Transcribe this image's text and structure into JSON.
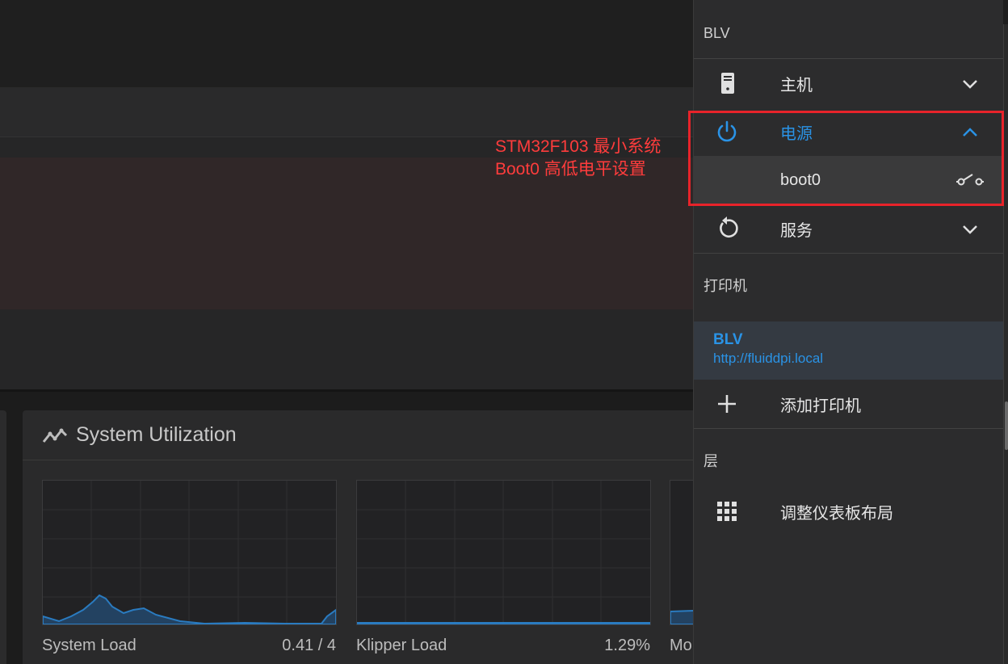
{
  "annotation": {
    "line1": "STM32F103 最小系统",
    "line2": "Boot0 高低电平设置"
  },
  "dashboard": {
    "card_title": "System Utilization",
    "graphs": [
      {
        "label": "System Load",
        "value": "0.41 / 4"
      },
      {
        "label": "Klipper Load",
        "value": "1.29%"
      },
      {
        "label": "Mo",
        "value": ""
      }
    ]
  },
  "drawer": {
    "section_host": "BLV",
    "items": {
      "host": {
        "label": "主机",
        "icon": "server-icon"
      },
      "power": {
        "label": "电源",
        "icon": "power-icon",
        "expanded": true
      },
      "boot0": {
        "label": "boot0",
        "icon": "toggle-switch-icon"
      },
      "services": {
        "label": "服务",
        "icon": "restart-icon"
      }
    },
    "section_printers": "打印机",
    "printer": {
      "name": "BLV",
      "url": "http://fluiddpi.local"
    },
    "add_printer": {
      "label": "添加打印机",
      "icon": "plus-icon"
    },
    "section_layout": "层",
    "adjust_layout": {
      "label": "调整仪表板布局",
      "icon": "grid-icon"
    }
  },
  "colors": {
    "accent": "#2a93e6",
    "annotation": "#ff3c3c",
    "highlight_box": "#e8232a",
    "drawer_bg": "#2c2c2d"
  }
}
